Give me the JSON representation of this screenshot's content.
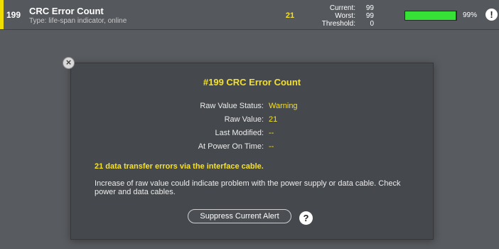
{
  "colors": {
    "accent": "#f0de00",
    "value": "#f5e12a",
    "bar": "#35e235",
    "panel": "#45484c",
    "background": "#585b5f"
  },
  "attribute_row": {
    "id": "199",
    "name": "CRC Error Count",
    "type": "Type: life-span indicator, online",
    "raw_value": "21",
    "stats": [
      {
        "label": "Current:",
        "value": "99"
      },
      {
        "label": "Worst:",
        "value": "99"
      },
      {
        "label": "Threshold:",
        "value": "0"
      }
    ],
    "health_fraction": 0.99,
    "health_percent": "99%",
    "status_icon": "alert-icon"
  },
  "detail_panel": {
    "close_icon": "close-icon",
    "title": "#199 CRC Error Count",
    "fields": [
      {
        "label": "Raw Value Status:",
        "value": "Warning"
      },
      {
        "label": "Raw Value:",
        "value": "21"
      },
      {
        "label": "Last Modified:",
        "value": "--"
      },
      {
        "label": "At Power On Time:",
        "value": "--"
      }
    ],
    "alert": "21 data transfer errors via the interface cable.",
    "description": "Increase of raw value could indicate problem with the power supply or data cable. Check power and data cables.",
    "suppress_label": "Suppress Current Alert",
    "help_icon": "help-icon"
  }
}
